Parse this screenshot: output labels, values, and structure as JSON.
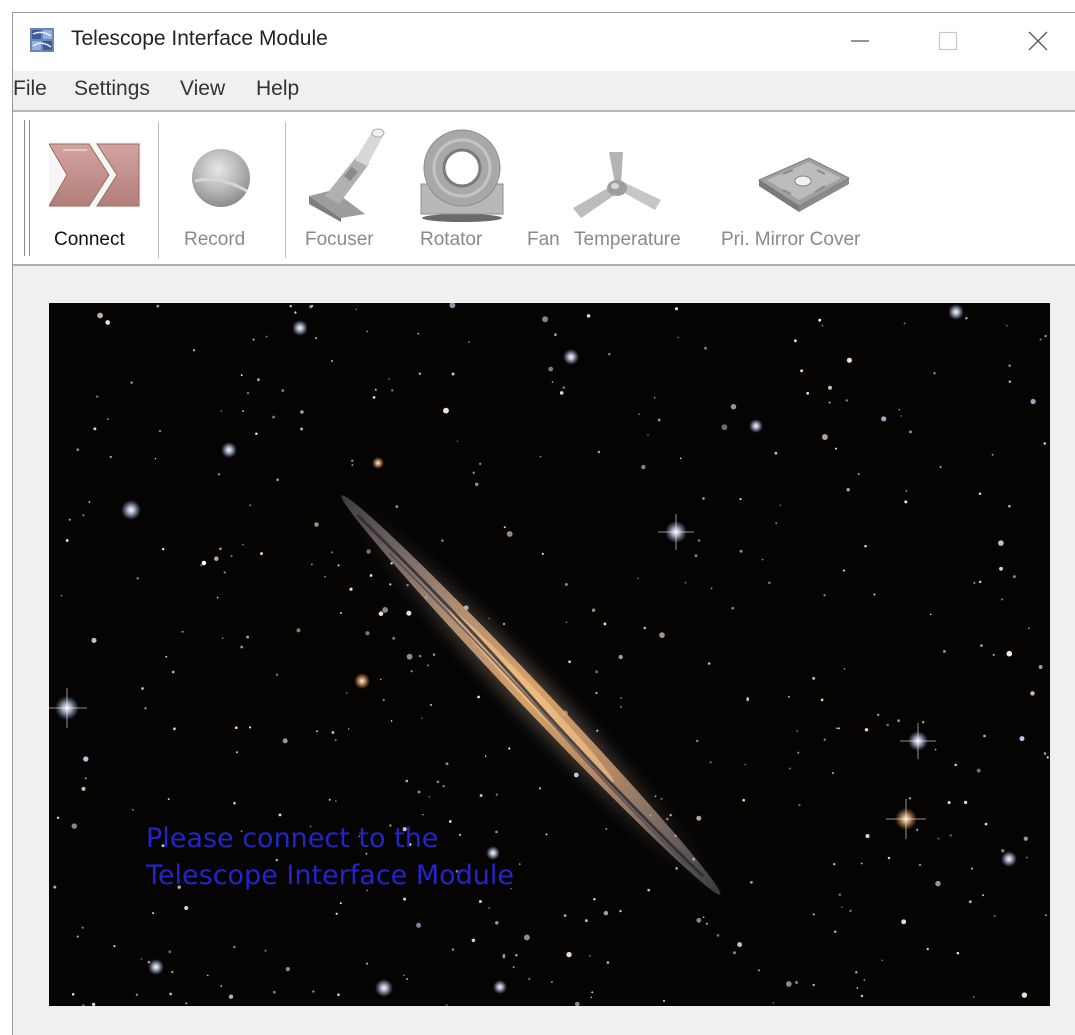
{
  "window": {
    "title": "Telescope Interface Module",
    "icon": "tim-app-icon"
  },
  "window_controls": {
    "minimize_icon": "minimize-icon",
    "maximize_icon": "maximize-icon",
    "close_icon": "close-icon"
  },
  "menu": {
    "items": [
      {
        "label": "File"
      },
      {
        "label": "Settings"
      },
      {
        "label": "View"
      },
      {
        "label": "Help"
      }
    ]
  },
  "toolbar": {
    "buttons": [
      {
        "label": "Connect",
        "icon": "connect-chevrons-icon",
        "enabled": true
      },
      {
        "label": "Record",
        "icon": "record-sphere-icon",
        "enabled": false
      },
      {
        "label": "Focuser",
        "icon": "focuser-icon",
        "enabled": false
      },
      {
        "label": "Rotator",
        "icon": "rotator-icon",
        "enabled": false
      },
      {
        "label": "Fan",
        "icon": "fan-icon",
        "enabled": false
      },
      {
        "label": "Temperature",
        "icon": "temperature-icon",
        "enabled": false
      },
      {
        "label": "Pri. Mirror Cover",
        "icon": "mirror-cover-icon",
        "enabled": false
      }
    ]
  },
  "viewport": {
    "background_image": "edge-on-galaxy-starfield",
    "message_lines": [
      "Please connect to the",
      "Telescope Interface Module"
    ],
    "message_color": "#2424c8"
  }
}
